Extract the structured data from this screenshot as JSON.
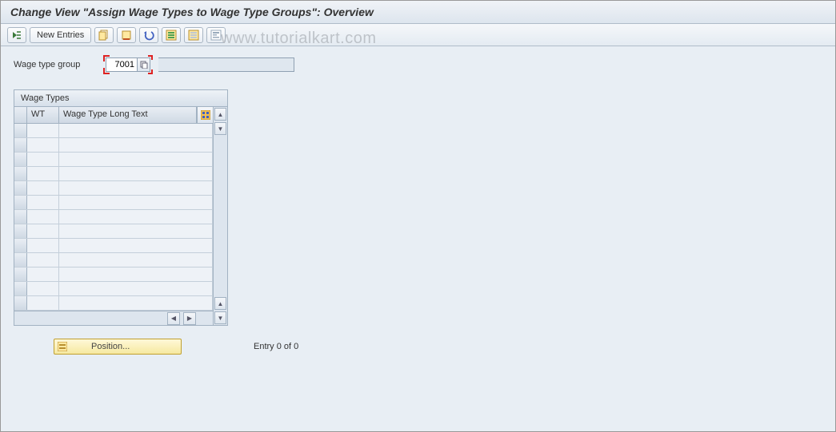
{
  "title": "Change View \"Assign Wage Types to Wage Type Groups\": Overview",
  "toolbar": {
    "new_entries": "New Entries"
  },
  "field": {
    "wage_type_group_label": "Wage type group",
    "wage_type_group_value": "7001"
  },
  "table": {
    "title": "Wage Types",
    "col_wt": "WT",
    "col_text": "Wage Type Long Text",
    "row_count": 13
  },
  "footer": {
    "position_label": "Position...",
    "entry_text": "Entry 0 of 0"
  },
  "watermark": "www.tutorialkart.com"
}
